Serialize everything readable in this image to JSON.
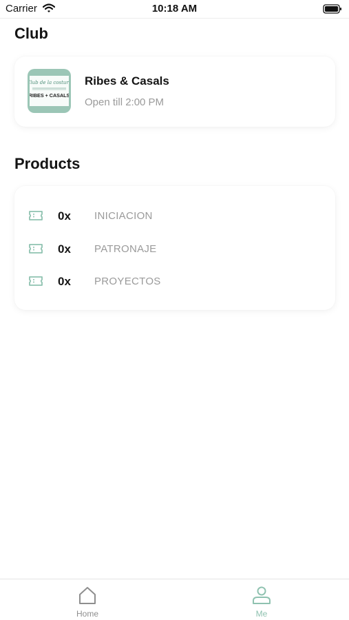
{
  "status_bar": {
    "carrier": "Carrier",
    "time": "10:18 AM"
  },
  "club_section": {
    "title": "Club",
    "club": {
      "logo_lines": [
        "Club de la costura",
        "RIBES + CASALS"
      ],
      "name": "Ribes & Casals",
      "hours": "Open till 2:00 PM"
    }
  },
  "products_section": {
    "title": "Products",
    "items": [
      {
        "qty": "0x",
        "name": "INICIACION",
        "icon": "ticket-icon"
      },
      {
        "qty": "0x",
        "name": "PATRONAJE",
        "icon": "ticket-icon"
      },
      {
        "qty": "0x",
        "name": "PROYECTOS",
        "icon": "ticket-icon"
      }
    ]
  },
  "tab_bar": {
    "tabs": [
      {
        "label": "Home",
        "icon": "home-icon",
        "active": false
      },
      {
        "label": "Me",
        "icon": "user-icon",
        "active": true
      }
    ]
  },
  "colors": {
    "accent": "#8fc2b0",
    "muted_text": "#9a9a9a",
    "logo_bg": "#9bc6b6"
  }
}
